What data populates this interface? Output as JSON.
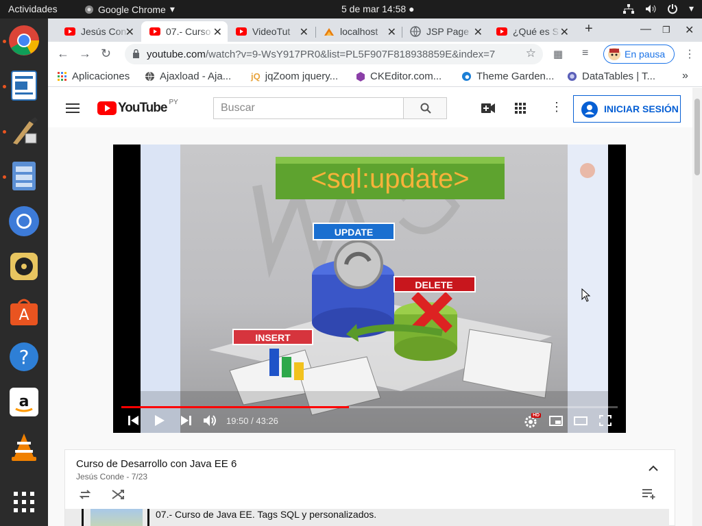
{
  "gnome": {
    "activities": "Actividades",
    "app_name": "Google Chrome",
    "clock": "5 de mar  14:58"
  },
  "dock": {
    "items": [
      "chrome-icon",
      "writer-icon",
      "paint-icon",
      "files-icon",
      "chromium-icon",
      "rhythmbox-icon",
      "software-store-icon",
      "help-icon",
      "amazon-icon",
      "vlc-icon",
      "app-grid-icon"
    ]
  },
  "tabs": [
    {
      "title": "Jesús Con",
      "favicon": "youtube",
      "active": false
    },
    {
      "title": "07.- Curso",
      "favicon": "youtube",
      "active": true
    },
    {
      "title": "VideoTut",
      "favicon": "youtube",
      "active": false
    },
    {
      "title": "localhost",
      "favicon": "local",
      "active": false
    },
    {
      "title": "JSP Page",
      "favicon": "globe",
      "active": false
    },
    {
      "title": "¿Qué es S",
      "favicon": "youtube",
      "active": false
    }
  ],
  "toolbar": {
    "url_host": "youtube.com",
    "url_path": "/watch?v=9-WsY917PR0&list=PL5F907F818938859E&index=7",
    "profile_label": "En pausa"
  },
  "bookmarks": [
    "Aplicaciones",
    "Ajaxload - Aja...",
    "jqZoom jquery...",
    "CKEditor.com...",
    "Theme Garden...",
    "DataTables | T..."
  ],
  "youtube": {
    "logo": "YouTube",
    "country": "PY",
    "search_placeholder": "Buscar",
    "signin": "INICIAR SESIÓN"
  },
  "video": {
    "slide_title": "<sql:update>",
    "label_update": "UPDATE",
    "label_delete": "DELETE",
    "label_insert": "INSERT",
    "time": "19:50 / 43:26",
    "progress": 0.458,
    "hd_badge": "HD"
  },
  "playlist": {
    "title": "Curso de Desarrollo con Java EE 6",
    "subtitle": "Jesús Conde - 7/23",
    "current_item": "07.- Curso de Java EE. Tags SQL y personalizados."
  },
  "colors": {
    "youtube_red": "#ff0000",
    "link_blue": "#065fd4",
    "ubuntu_orange": "#e95420"
  }
}
